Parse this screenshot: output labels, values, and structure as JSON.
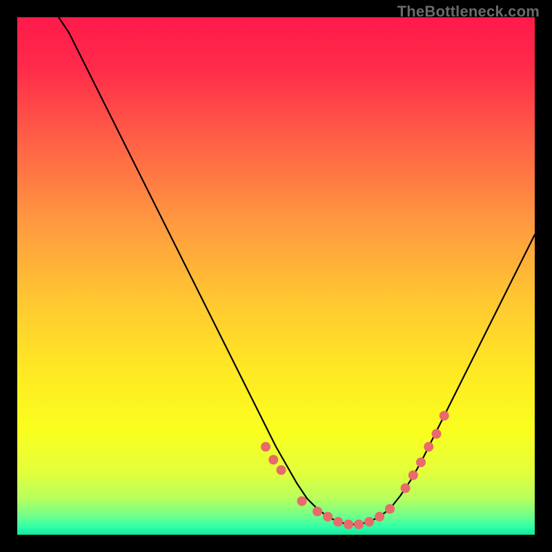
{
  "watermark": "TheBottleneck.com",
  "gradient_stops": [
    {
      "offset": 0.0,
      "color": "#ff1a4b"
    },
    {
      "offset": 0.1,
      "color": "#ff2b4a"
    },
    {
      "offset": 0.22,
      "color": "#ff5a47"
    },
    {
      "offset": 0.4,
      "color": "#ff9a40"
    },
    {
      "offset": 0.55,
      "color": "#ffc831"
    },
    {
      "offset": 0.68,
      "color": "#ffe824"
    },
    {
      "offset": 0.8,
      "color": "#faff1e"
    },
    {
      "offset": 0.88,
      "color": "#e2ff3c"
    },
    {
      "offset": 0.93,
      "color": "#b7ff5e"
    },
    {
      "offset": 0.965,
      "color": "#6dff8c"
    },
    {
      "offset": 0.985,
      "color": "#2fffa9"
    },
    {
      "offset": 1.0,
      "color": "#11e79d"
    }
  ],
  "chart_data": {
    "type": "line",
    "title": "",
    "xlabel": "",
    "ylabel": "",
    "xlim": [
      0,
      100
    ],
    "ylim": [
      0,
      100
    ],
    "grid": false,
    "series": [
      {
        "name": "curve",
        "x": [
          8,
          10,
          12,
          14,
          16,
          18,
          20,
          22,
          24,
          26,
          28,
          30,
          32,
          34,
          36,
          38,
          40,
          42,
          44,
          46,
          48,
          50,
          52,
          54,
          56,
          58,
          60,
          62,
          64,
          66,
          68,
          70,
          72,
          74,
          76,
          78,
          80,
          82,
          84,
          86,
          88,
          90,
          92,
          94,
          96,
          98,
          100
        ],
        "y": [
          100,
          97,
          93,
          89,
          85,
          81,
          77,
          73,
          69,
          65,
          61,
          57,
          53,
          49,
          45,
          41,
          37,
          33,
          29,
          25,
          21,
          17,
          13.5,
          10,
          7,
          5,
          3.5,
          2.5,
          2,
          2,
          2.5,
          3.5,
          5,
          7.5,
          10.5,
          14,
          18,
          22,
          26,
          30,
          34,
          38,
          42,
          46,
          50,
          54,
          58
        ]
      }
    ],
    "dots": {
      "name": "highlight-dots",
      "color": "#e86a6a",
      "radius_px": 7,
      "x": [
        48,
        49.5,
        51,
        55,
        58,
        60,
        62,
        64,
        66,
        68,
        70,
        72,
        75,
        76.5,
        78,
        79.5,
        81,
        82.5
      ],
      "y": [
        17,
        14.5,
        12.5,
        6.5,
        4.5,
        3.5,
        2.5,
        2,
        2,
        2.5,
        3.5,
        5,
        9,
        11.5,
        14,
        17,
        19.5,
        23
      ]
    }
  }
}
